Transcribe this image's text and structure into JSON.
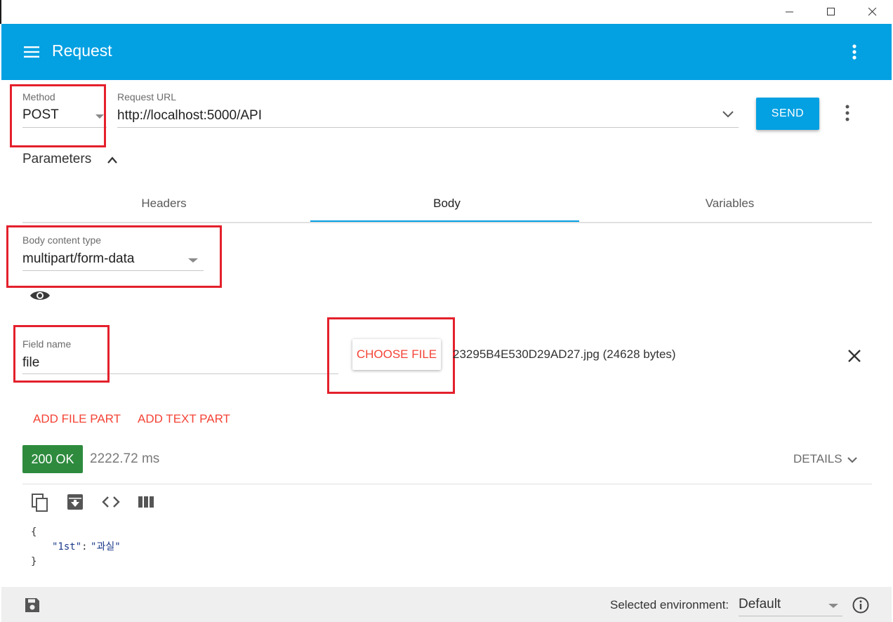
{
  "app": {
    "title": "Request"
  },
  "request": {
    "method_label": "Method",
    "method_value": "POST",
    "url_label": "Request URL",
    "url_value": "http://localhost:5000/API",
    "send_label": "SEND"
  },
  "parameters": {
    "label": "Parameters"
  },
  "tabs": [
    {
      "label": "Headers"
    },
    {
      "label": "Body"
    },
    {
      "label": "Variables"
    }
  ],
  "body": {
    "content_type_label": "Body content type",
    "content_type_value": "multipart/form-data",
    "field_name_label": "Field name",
    "field_name_value": "file",
    "choose_file_label": "CHOOSE FILE",
    "file_info": "23295B4E530D29AD27.jpg (24628 bytes)",
    "add_file_part": "ADD FILE PART",
    "add_text_part": "ADD TEXT PART"
  },
  "response": {
    "status": "200 OK",
    "time": "2222.72 ms",
    "details_label": "DETAILS",
    "json_open": "{",
    "json_key": "\"1st\"",
    "json_colon": ":",
    "json_value": "\"과실\"",
    "json_close": "}"
  },
  "footer": {
    "env_label": "Selected environment:",
    "env_value": "Default"
  },
  "colors": {
    "accent": "#03a0e2",
    "status_ok": "#2e8b3e",
    "link_red": "#f44336",
    "highlight_red": "#e4202c"
  }
}
